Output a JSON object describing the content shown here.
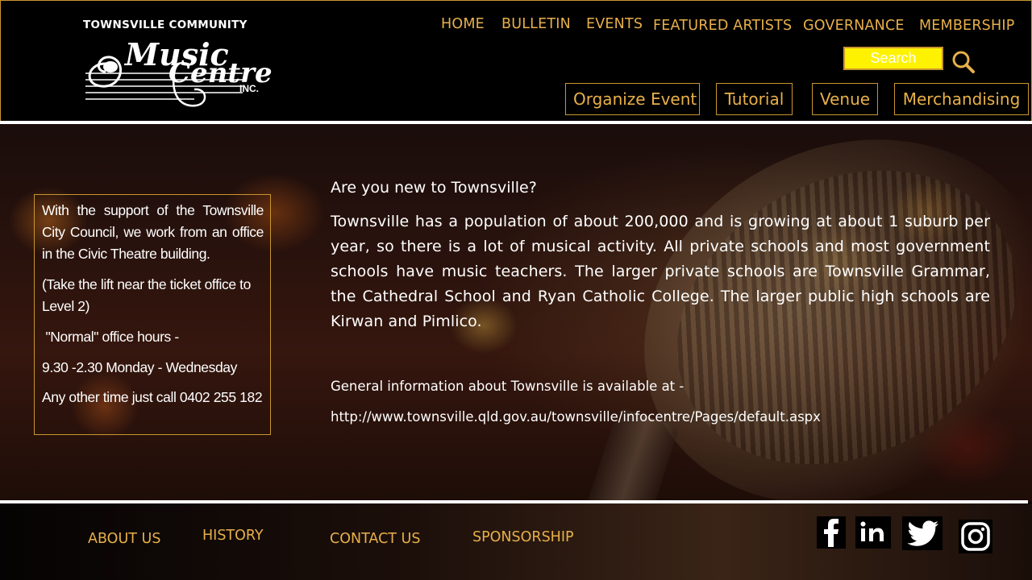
{
  "logo": {
    "top_text": "TOWNSVILLE COMMUNITY",
    "script_line1": "Music",
    "script_line2": "Centre",
    "suffix": "INC.",
    "icon": "treble-note-logo-icon"
  },
  "nav": {
    "items": [
      "HOME",
      "BULLETIN",
      "EVENTS",
      "FEATURED ARTISTS",
      "GOVERNANCE",
      "MEMBERSHIP"
    ]
  },
  "search": {
    "label": "Search",
    "icon": "search-icon"
  },
  "subnav": {
    "items": [
      "Organize Event",
      "Tutorial",
      "Venue",
      "Merchandising"
    ]
  },
  "info_box": {
    "p1": "With the support of the Townsville City Council, we work from an office in the Civic Theatre building.",
    "p2": "(Take the lift near the ticket office to Level 2)",
    "p3": " \"Normal\" office hours -",
    "p4": "9.30 -2.30 Monday - Wednesday",
    "p5": "Any other time just call 0402 255 182"
  },
  "main": {
    "question": "Are you new to Townsville?",
    "body": "Townsville has a population of about 200,000 and is growing at about 1 suburb per year, so there is a lot of musical activity. All private schools and most government schools have music teachers. The larger private schools are Townsville Grammar, the Cathedral School and Ryan Catholic College. The larger public high schools are Kirwan and Pimlico.",
    "general_info": "General information about Townsville is available at -",
    "url": "http://www.townsville.qld.gov.au/townsville/infocentre/Pages/default.aspx"
  },
  "footer": {
    "links": [
      "ABOUT US",
      "HISTORY",
      "CONTACT US",
      "SPONSORSHIP"
    ],
    "social_icons": [
      "facebook-icon",
      "linkedin-icon",
      "twitter-icon",
      "instagram-icon"
    ]
  },
  "colors": {
    "accent": "#e8b04a",
    "border": "#c9962e",
    "search_bg": "#fff200",
    "background": "#000000"
  }
}
